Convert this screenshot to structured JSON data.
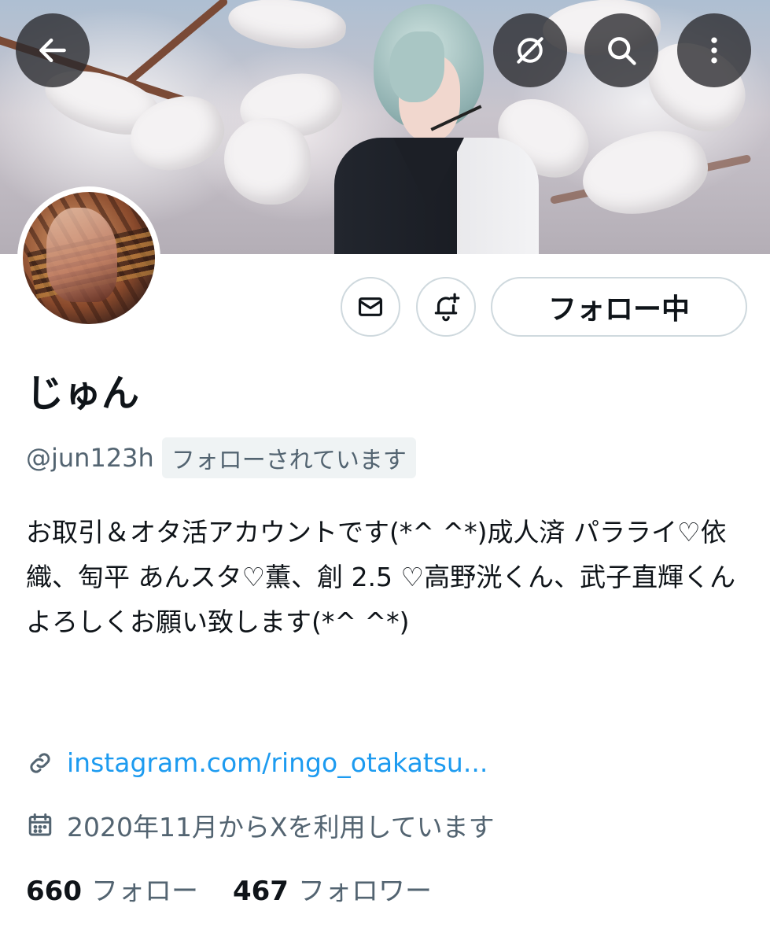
{
  "header": {
    "back_icon": "arrow-left-icon",
    "grok_icon": "grok-icon",
    "search_icon": "search-icon",
    "more_icon": "more-vertical-icon"
  },
  "actions": {
    "message_icon": "mail-icon",
    "notify_icon": "bell-plus-icon",
    "follow_label": "フォロー中"
  },
  "profile": {
    "display_name": "じゅん",
    "handle": "@jun123h",
    "follows_you": "フォローされています",
    "bio": "お取引＆オタ活アカウントです(*^ ^*)成人済 パラライ♡依織、匋平 あんスタ♡薫、創 2.5 ♡高野洸くん、武子直輝くん よろしくお願い致します(*^ ^*)",
    "link": "instagram.com/ringo_otakatsu...",
    "joined": "2020年11月からXを利用しています"
  },
  "stats": {
    "following_count": "660",
    "following_label": "フォロー",
    "followers_count": "467",
    "followers_label": "フォロワー"
  },
  "colors": {
    "link": "#1d9bf0",
    "secondary_text": "#536471",
    "border": "#cfd9de"
  }
}
